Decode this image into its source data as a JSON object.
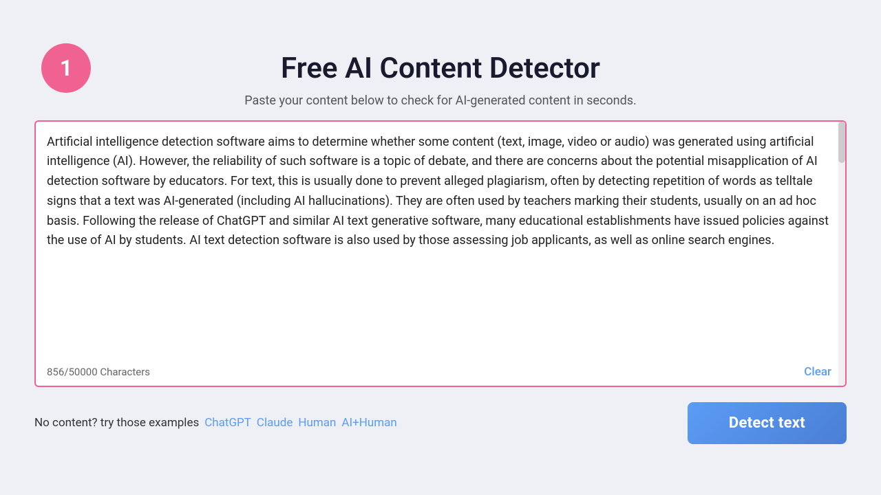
{
  "page": {
    "title": "Free AI Content Detector",
    "subtitle": "Paste your content below to check for AI-generated content in seconds.",
    "step_number": "1",
    "step_badge_color": "#f06292"
  },
  "textarea": {
    "content": "Artificial intelligence detection software aims to determine whether some content (text, image, video or audio) was generated using artificial intelligence (AI). However, the reliability of such software is a topic of debate, and there are concerns about the potential misapplication of AI detection software by educators. For text, this is usually done to prevent alleged plagiarism, often by detecting repetition of words as telltale signs that a text was AI-generated (including AI hallucinations). They are often used by teachers marking their students, usually on an ad hoc basis. Following the release of ChatGPT and similar AI text generative software, many educational establishments have issued policies against the use of AI by students. AI text detection software is also used by those assessing job applicants, as well as online search engines.",
    "char_count": "856/50000 Characters",
    "clear_label": "Clear"
  },
  "bottom": {
    "no_content_text": "No content?",
    "try_text": "try",
    "those_examples_text": "those examples",
    "examples": [
      {
        "label": "ChatGPT"
      },
      {
        "label": "Claude"
      },
      {
        "label": "Human"
      },
      {
        "label": "AI+Human"
      }
    ],
    "detect_button_label": "Detect text"
  }
}
